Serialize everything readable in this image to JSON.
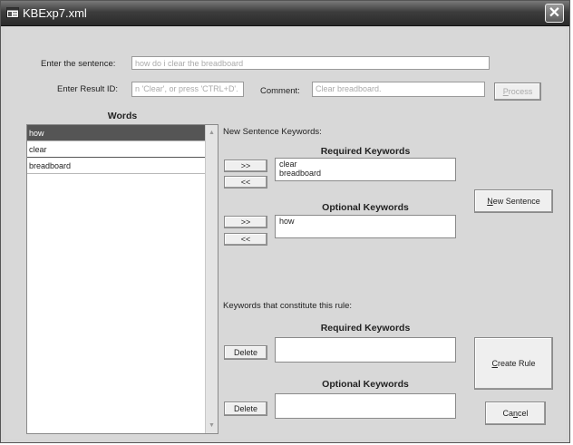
{
  "window": {
    "title": "KBExp7.xml"
  },
  "form": {
    "sentence_label": "Enter the sentence:",
    "sentence_value": "how do i clear the breadboard",
    "result_id_label": "Enter Result ID:",
    "result_id_value": "n 'Clear', or press 'CTRL+D'.",
    "comment_label": "Comment:",
    "comment_value": "Clear breadboard.",
    "process_prefix": "",
    "process_key": "P",
    "process_rest": "rocess"
  },
  "words": {
    "heading": "Words",
    "items": [
      "how",
      "clear",
      "breadboard"
    ]
  },
  "new_keywords": {
    "section_label": "New Sentence Keywords:",
    "required_heading": "Required Keywords",
    "required_items": [
      "clear",
      "breadboard"
    ],
    "optional_heading": "Optional Keywords",
    "optional_items": [
      "how"
    ],
    "add_label": ">>",
    "remove_label": "<<"
  },
  "rule": {
    "section_label": "Keywords that constitute this rule:",
    "required_heading": "Required Keywords",
    "optional_heading": "Optional Keywords",
    "delete_label": "Delete",
    "required_value": "",
    "optional_value": ""
  },
  "buttons": {
    "new_sentence_key": "N",
    "new_sentence_rest": "ew Sentence",
    "create_rule_key": "C",
    "create_rule_rest": "reate Rule",
    "cancel_pre": "Ca",
    "cancel_key": "n",
    "cancel_rest": "cel"
  }
}
